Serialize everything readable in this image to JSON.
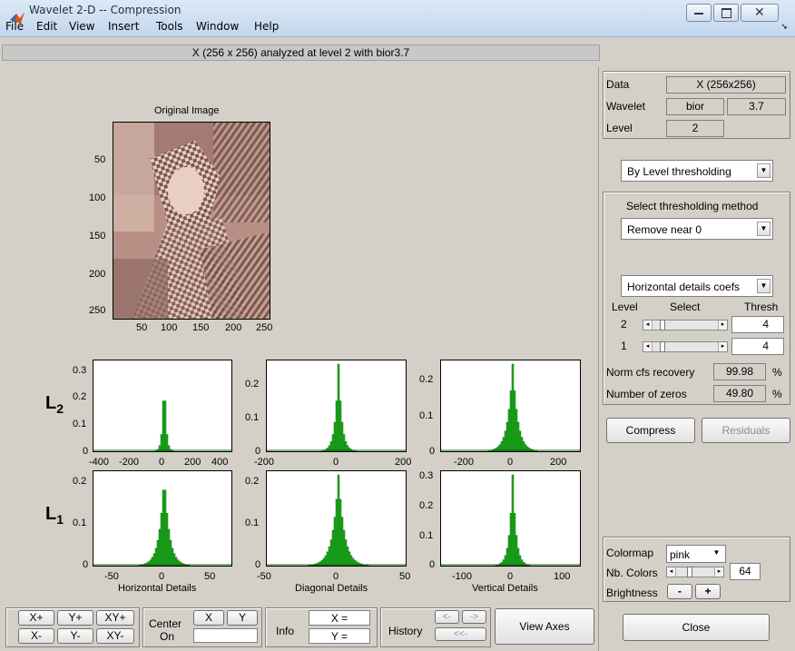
{
  "window": {
    "title": "Wavelet 2-D  --  Compression"
  },
  "menu": [
    "File",
    "Edit",
    "View",
    "Insert",
    "Tools",
    "Window",
    "Help"
  ],
  "header": {
    "status": "X  (256 x 256) analyzed at level 2 with bior3.7"
  },
  "original": {
    "title": "Original Image",
    "yticks": [
      "50",
      "100",
      "150",
      "200",
      "250"
    ],
    "xticks": [
      "50",
      "100",
      "150",
      "200",
      "250"
    ]
  },
  "levels": {
    "l2": "L",
    "l2sub": "2",
    "l1": "L",
    "l1sub": "1"
  },
  "plots": {
    "l2_h": {
      "yticks": [
        "0.3",
        "0.2",
        "0.1",
        "0"
      ],
      "xticks": [
        "-400",
        "-200",
        "0",
        "200",
        "400"
      ]
    },
    "l2_d": {
      "yticks": [
        "0.2",
        "0.1",
        "0"
      ],
      "xticks": [
        "-200",
        "0",
        "200"
      ]
    },
    "l2_v": {
      "yticks": [
        "0.2",
        "0.1",
        "0"
      ],
      "xticks": [
        "-200",
        "0",
        "200"
      ]
    },
    "l1_h": {
      "yticks": [
        "0.2",
        "0.1",
        "0"
      ],
      "xticks": [
        "-50",
        "0",
        "50"
      ],
      "title": "Horizontal Details"
    },
    "l1_d": {
      "yticks": [
        "0.2",
        "0.1",
        "0"
      ],
      "xticks": [
        "-50",
        "0",
        "50"
      ],
      "title": "Diagonal Details"
    },
    "l1_v": {
      "yticks": [
        "0.3",
        "0.2",
        "0.1",
        "0"
      ],
      "xticks": [
        "-100",
        "0",
        "100"
      ],
      "title": "Vertical Details"
    }
  },
  "right": {
    "data_label": "Data",
    "data_value": "X  (256x256)",
    "wavelet_label": "Wavelet",
    "wavelet_family": "bior",
    "wavelet_num": "3.7",
    "level_label": "Level",
    "level_value": "2",
    "threshold_mode": "By Level thresholding",
    "select_method_title": "Select thresholding method",
    "method": "Remove near 0",
    "coefs": "Horizontal details coefs",
    "col_level": "Level",
    "col_select": "Select",
    "col_thresh": "Thresh",
    "rows": [
      {
        "level": "2",
        "thresh": "4"
      },
      {
        "level": "1",
        "thresh": "4"
      }
    ],
    "norm_label": "Norm cfs recovery",
    "norm_value": "99.98",
    "pct": "%",
    "zeros_label": "Number of zeros",
    "zeros_value": "49.80",
    "compress": "Compress",
    "residuals": "Residuals",
    "colormap_label": "Colormap",
    "colormap_value": "pink",
    "nbcolors_label": "Nb. Colors",
    "nbcolors_value": "64",
    "brightness_label": "Brightness",
    "bright_minus": "-",
    "bright_plus": "+",
    "close": "Close"
  },
  "bottom": {
    "xp": "X+",
    "yp": "Y+",
    "xyp": "XY+",
    "xm": "X-",
    "ym": "Y-",
    "xym": "XY-",
    "center": "Center",
    "center_on": "On",
    "cx": "X",
    "cy": "Y",
    "info": "Info",
    "info_x": "X =",
    "info_y": "Y =",
    "history": "History",
    "hist_back": "<-",
    "hist_fwd": "->",
    "hist_first": "<<-",
    "view_axes": "View Axes"
  },
  "colors": {
    "histogram": "#0a6b0a",
    "histogram_fill": "#1fae1f",
    "image_tint": "#c79a8c"
  }
}
